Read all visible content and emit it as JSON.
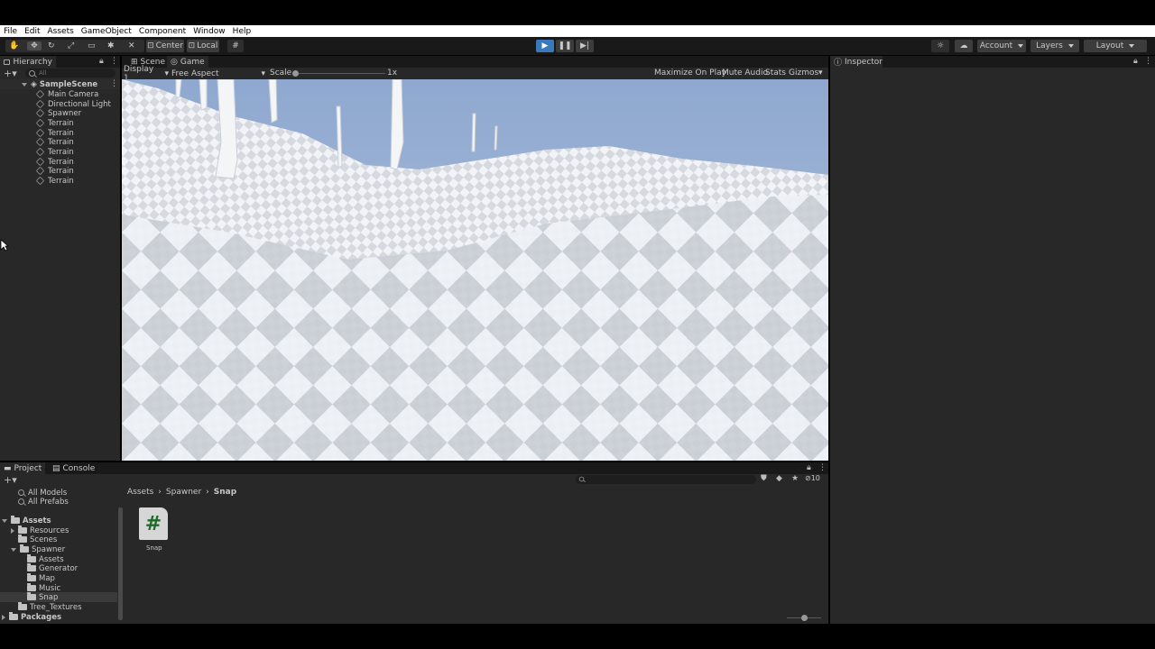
{
  "menu": [
    "File",
    "Edit",
    "Assets",
    "GameObject",
    "Component",
    "Window",
    "Help"
  ],
  "toolbar": {
    "pivot": "Center",
    "space": "Local",
    "account": "Account",
    "layers": "Layers",
    "layout": "Layout"
  },
  "hierarchy": {
    "tab": "Hierarchy",
    "search_placeholder": "All",
    "scene": "SampleScene",
    "items": [
      "Main Camera",
      "Directional Light",
      "Spawner",
      "Terrain",
      "Terrain",
      "Terrain",
      "Terrain",
      "Terrain",
      "Terrain",
      "Terrain"
    ]
  },
  "game_view": {
    "tabs": [
      "Scene",
      "Game"
    ],
    "display": "Display 1",
    "aspect": "Free Aspect",
    "scale_label": "Scale",
    "scale_value": "1x",
    "options": [
      "Maximize On Play",
      "Mute Audio",
      "Stats",
      "Gizmos"
    ]
  },
  "inspector": {
    "tab": "Inspector"
  },
  "project": {
    "tabs": [
      "Project",
      "Console"
    ],
    "favorites": [
      "All Models",
      "All Prefabs"
    ],
    "tree": {
      "assets": "Assets",
      "resources": "Resources",
      "scenes": "Scenes",
      "spawner": "Spawner",
      "spawner_children": [
        "Assets",
        "Generator",
        "Map",
        "Music",
        "Snap"
      ],
      "tree_textures": "Tree_Textures",
      "packages": "Packages"
    },
    "breadcrumb": [
      "Assets",
      "Spawner",
      "Snap"
    ],
    "hidden_count": "10",
    "asset_name": "Snap",
    "asset_glyph": "#"
  },
  "colors": {
    "panel": "#282828",
    "toolbar": "#191919",
    "play_active": "#3a79bb",
    "sky": "#a9bfdf",
    "script_green": "#1e6b2a"
  }
}
